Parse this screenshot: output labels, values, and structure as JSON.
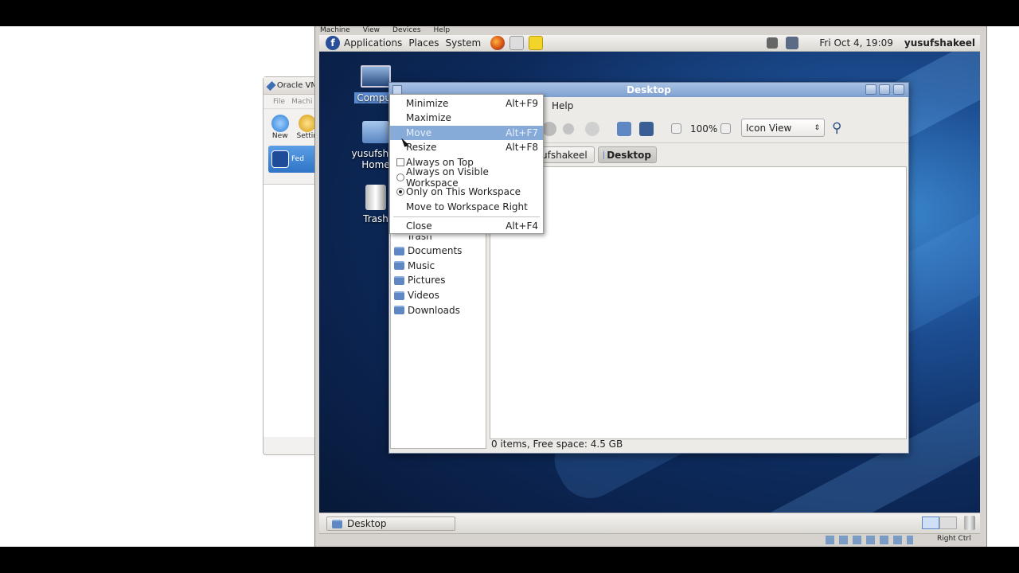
{
  "host": {
    "oracle_title": "Oracle VM",
    "oracle_menu": [
      "File",
      "Machi"
    ],
    "tools": [
      {
        "label": "New"
      },
      {
        "label": "Settin"
      }
    ],
    "vm_label": "Fed"
  },
  "vbox_menu": [
    "Machine",
    "View",
    "Devices",
    "Help"
  ],
  "panel": {
    "applications": "Applications",
    "places": "Places",
    "system": "System",
    "clock": "Fri Oct  4, 19:09",
    "user": "yusufshakeel"
  },
  "desktop_icons": [
    {
      "label": "Comput"
    },
    {
      "label": "yusufshak",
      "label2": "Home"
    },
    {
      "label": "Trash"
    }
  ],
  "nautilus": {
    "title": "Desktop",
    "menu_help": "Help",
    "zoom": "100%",
    "view_mode": "Icon View",
    "crumb_home": "ufshakeel",
    "crumb_desktop": "Desktop",
    "sidebar_partial": "Trash",
    "sidebar": [
      "Documents",
      "Music",
      "Pictures",
      "Videos",
      "Downloads"
    ],
    "status": "0 items, Free space: 4.5 GB"
  },
  "context_menu": {
    "minimize": {
      "label": "Minimize",
      "accel": "Alt+F9"
    },
    "maximize": {
      "label": "Maximize"
    },
    "move": {
      "label": "Move",
      "accel": "Alt+F7"
    },
    "resize": {
      "label": "Resize",
      "accel": "Alt+F8"
    },
    "always_on_top": {
      "label": "Always on Top"
    },
    "always_visible": {
      "label": "Always on Visible Workspace"
    },
    "only_this": {
      "label": "Only on This Workspace"
    },
    "move_right": {
      "label": "Move to Workspace Right"
    },
    "close": {
      "label": "Close",
      "accel": "Alt+F4"
    }
  },
  "taskbar": {
    "window_button": "Desktop"
  },
  "vbox_status": {
    "host_key": "Right Ctrl"
  },
  "colors": {
    "accent": "#86abd9",
    "titlebar": "#7d9fd0",
    "desktop": "#1d4f94"
  }
}
